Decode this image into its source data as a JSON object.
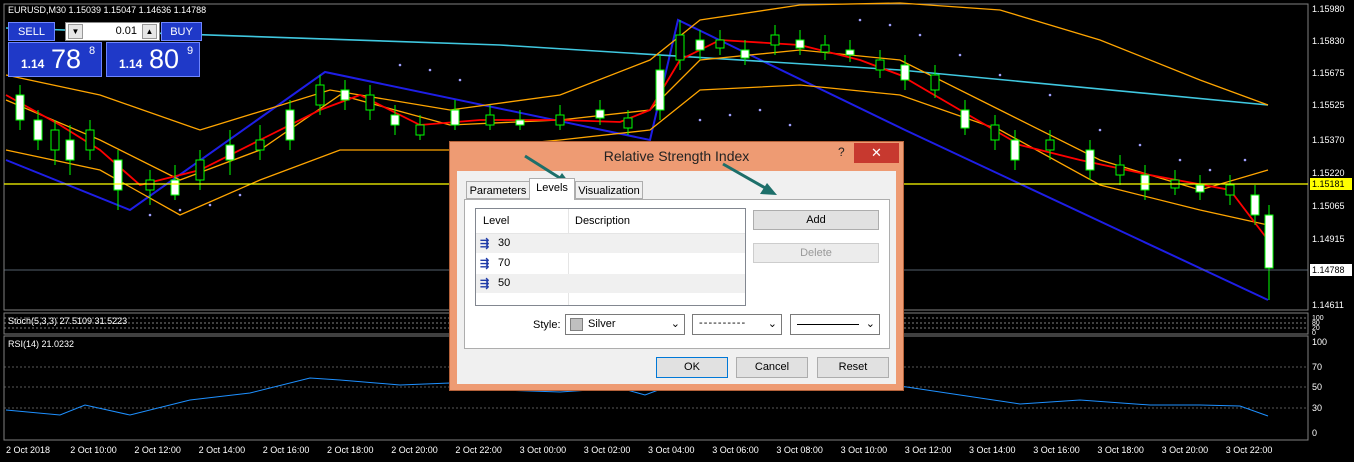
{
  "chart": {
    "header": "EURUSD,M30  1.15039 1.15047 1.14636 1.14788",
    "price_ticks": [
      "1.15980",
      "1.15830",
      "1.15675",
      "1.15525",
      "1.15370",
      "1.15220",
      "1.15065",
      "1.14915",
      "1.14611"
    ],
    "current_price_label": "1.14788",
    "hline_label": "1.15181",
    "time_ticks": [
      "2 Oct 2018",
      "2 Oct 10:00",
      "2 Oct 12:00",
      "2 Oct 14:00",
      "2 Oct 16:00",
      "2 Oct 18:00",
      "2 Oct 20:00",
      "2 Oct 22:00",
      "3 Oct 00:00",
      "3 Oct 02:00",
      "3 Oct 04:00",
      "3 Oct 06:00",
      "3 Oct 08:00",
      "3 Oct 10:00",
      "3 Oct 12:00",
      "3 Oct 14:00",
      "3 Oct 16:00",
      "3 Oct 18:00",
      "3 Oct 20:00",
      "3 Oct 22:00"
    ],
    "stoch_label": "Stoch(5,3,3) 27.5109 31.5223",
    "stoch_ticks": [
      "100",
      "80",
      "20",
      "0"
    ],
    "rsi_label": "RSI(14) 21.0232",
    "rsi_ticks": [
      "100",
      "70",
      "50",
      "30",
      "0"
    ]
  },
  "trade_panel": {
    "sell_label": "SELL",
    "buy_label": "BUY",
    "lot_value": "0.01",
    "sell_price_small": "1.14",
    "sell_price_big": "78",
    "sell_price_sup": "8",
    "buy_price_small": "1.14",
    "buy_price_big": "80",
    "buy_price_sup": "9"
  },
  "dialog": {
    "title": "Relative Strength Index",
    "help": "?",
    "close": "✕",
    "tabs": [
      "Parameters",
      "Levels",
      "Visualization"
    ],
    "active_tab": "Levels",
    "levels_table": {
      "columns": [
        "Level",
        "Description"
      ],
      "rows": [
        {
          "level": "30",
          "description": ""
        },
        {
          "level": "70",
          "description": ""
        },
        {
          "level": "50",
          "description": ""
        }
      ]
    },
    "add_label": "Add",
    "delete_label": "Delete",
    "style_label": "Style:",
    "style_color_value": "Silver",
    "style_line_value": "- - - - - - - - - -",
    "style_width_value": "",
    "ok_label": "OK",
    "cancel_label": "Cancel",
    "reset_label": "Reset"
  },
  "colors": {
    "background": "#000000",
    "bull_candle": "#ffffff",
    "bear_candle": "#000000",
    "candle_outline": "#00ff00",
    "ma_red": "#ff0000",
    "ma_orange": "#ffa500",
    "ma_cyan": "#40c8e0",
    "trendline": "#1e1ee6",
    "hline": "#ffff00",
    "rsi_line": "#1e90ff",
    "dialog_frame": "#ee9b73",
    "annotation_arrow": "#1d6f6a"
  }
}
